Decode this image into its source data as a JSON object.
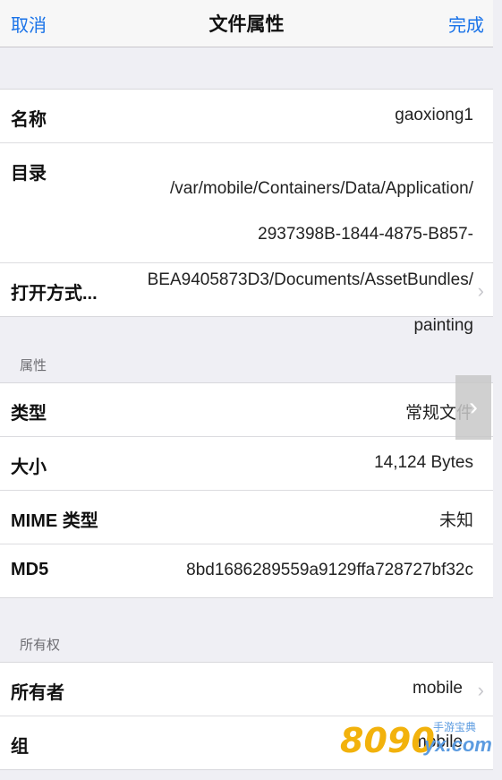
{
  "nav": {
    "cancel": "取消",
    "title": "文件属性",
    "done": "完成"
  },
  "info": {
    "name_label": "名称",
    "name_value": "gaoxiong1",
    "dir_label": "目录",
    "dir_lines": [
      "/var/mobile/Containers/Data/Application/",
      "2937398B-1844-4875-B857-",
      "BEA9405873D3/Documents/AssetBundles/",
      "painting"
    ],
    "open_with_label": "打开方式..."
  },
  "attributes": {
    "header": "属性",
    "type_label": "类型",
    "type_value": "常规文件",
    "size_label": "大小",
    "size_value": "14,124 Bytes",
    "mime_label": "MIME 类型",
    "mime_value": "未知",
    "md5_label": "MD5",
    "md5_value": "8bd1686289559a9129ffa728727bf32c"
  },
  "ownership": {
    "header": "所有权",
    "owner_label": "所有者",
    "owner_value": "mobile",
    "group_label": "组",
    "group_value": "mobile"
  },
  "watermark": {
    "number": "8090",
    "suffix": "yx.com",
    "tagline": "手游宝典"
  },
  "icons": {
    "chevron": "chevron-right-icon",
    "side_tab": "chevron-right-icon"
  },
  "colors": {
    "accent": "#1a73e8",
    "background": "#efeff4"
  }
}
